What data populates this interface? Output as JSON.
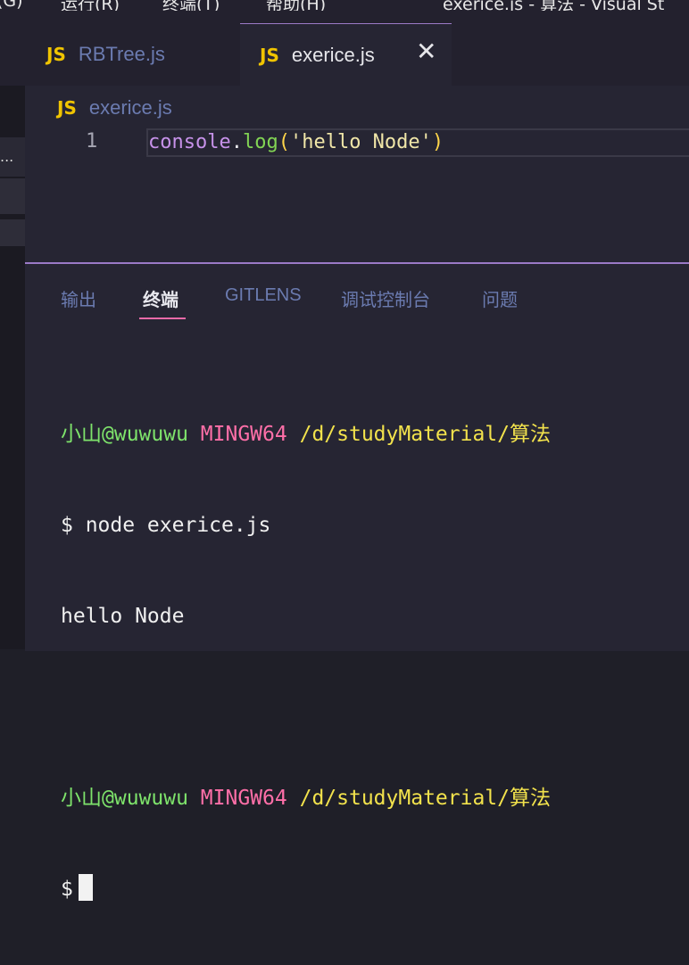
{
  "titlebar": {
    "menu": [
      "(G)",
      "运行(R)",
      "终端(T)",
      "帮助(H)"
    ],
    "window_title": "exerice.js - 算法 - Visual St"
  },
  "tabs": [
    {
      "icon": "JS",
      "label": "RBTree.js",
      "active": false
    },
    {
      "icon": "JS",
      "label": "exerice.js",
      "active": true,
      "close": "✕"
    }
  ],
  "sidebar": {
    "truncated_item": "..."
  },
  "editor": {
    "breadcrumb": {
      "icon": "JS",
      "file": "exerice.js"
    },
    "lines": [
      {
        "number": "1",
        "tokens": {
          "ident": "console",
          "dot": ".",
          "fn": "log",
          "open": "(",
          "str": "'hello Node'",
          "close": ")"
        }
      }
    ]
  },
  "panel": {
    "tabs": {
      "output": "输出",
      "terminal": "终端",
      "gitlens": "GITLENS",
      "debug": "调试控制台",
      "problems": "问题"
    },
    "active_tab": "终端"
  },
  "terminal": {
    "prompt1": {
      "user": "小山@wuwuwu",
      "host": "MINGW64",
      "path": "/d/studyMaterial/算法"
    },
    "command": "$ node exerice.js",
    "output": "hello Node",
    "prompt2": {
      "user": "小山@wuwuwu",
      "host": "MINGW64",
      "path": "/d/studyMaterial/算法"
    },
    "input_prompt": "$"
  },
  "colors": {
    "js_icon": "#f0c400",
    "accent": "#9b7ac7",
    "active_tab_underline": "#e86aa8",
    "terminal_user": "#7ee36b",
    "terminal_host": "#ff6fa8",
    "terminal_path": "#f2e24c"
  }
}
